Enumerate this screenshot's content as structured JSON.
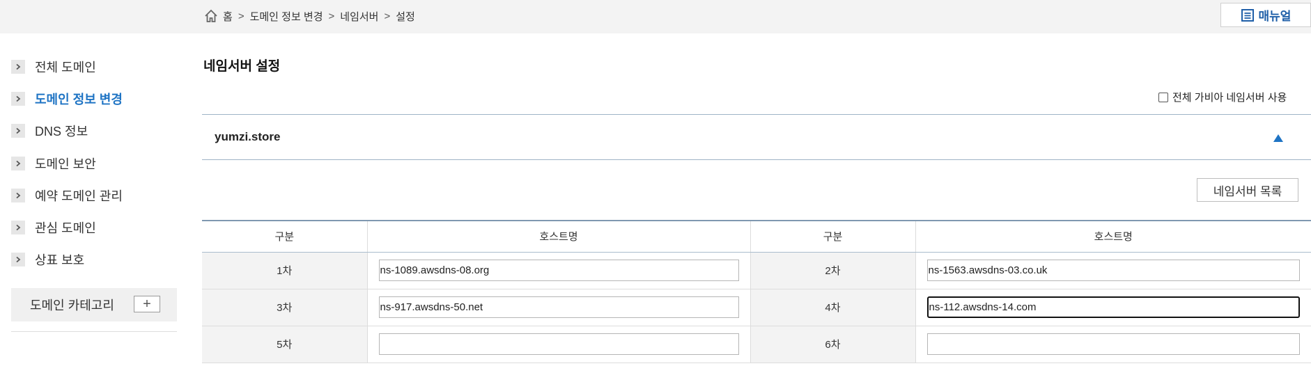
{
  "breadcrumb": {
    "home_icon": "home-icon",
    "items": [
      "홈",
      "도메인 정보 변경",
      "네임서버",
      "설정"
    ],
    "separator": ">"
  },
  "manual_button": {
    "label": "매뉴얼",
    "icon": "document-icon"
  },
  "sidebar": {
    "items": [
      {
        "label": "전체 도메인",
        "active": false
      },
      {
        "label": "도메인 정보 변경",
        "active": true
      },
      {
        "label": "DNS 정보",
        "active": false
      },
      {
        "label": "도메인 보안",
        "active": false
      },
      {
        "label": "예약 도메인 관리",
        "active": false
      },
      {
        "label": "관심 도메인",
        "active": false
      },
      {
        "label": "상표 보호",
        "active": false
      }
    ],
    "category": {
      "label": "도메인 카테고리",
      "add_symbol": "+"
    }
  },
  "main": {
    "title": "네임서버 설정",
    "all_gabia_label": "전체 가비아 네임서버 사용",
    "all_gabia_checked": false,
    "domain": "yumzi.store",
    "ns_list_button": "네임서버 목록",
    "table": {
      "headers": [
        "구분",
        "호스트명",
        "구분",
        "호스트명"
      ],
      "rows": [
        {
          "left_label": "1차",
          "left_value": "ns-1089.awsdns-08.org",
          "right_label": "2차",
          "right_value": "ns-1563.awsdns-03.co.uk"
        },
        {
          "left_label": "3차",
          "left_value": "ns-917.awsdns-50.net",
          "right_label": "4차",
          "right_value": "ns-112.awsdns-14.com"
        },
        {
          "left_label": "5차",
          "left_value": "",
          "right_label": "6차",
          "right_value": ""
        }
      ]
    }
  },
  "colors": {
    "accent": "#1f74c4",
    "topbar_bg": "#f3f3f3",
    "table_border": "#7f98b0"
  }
}
